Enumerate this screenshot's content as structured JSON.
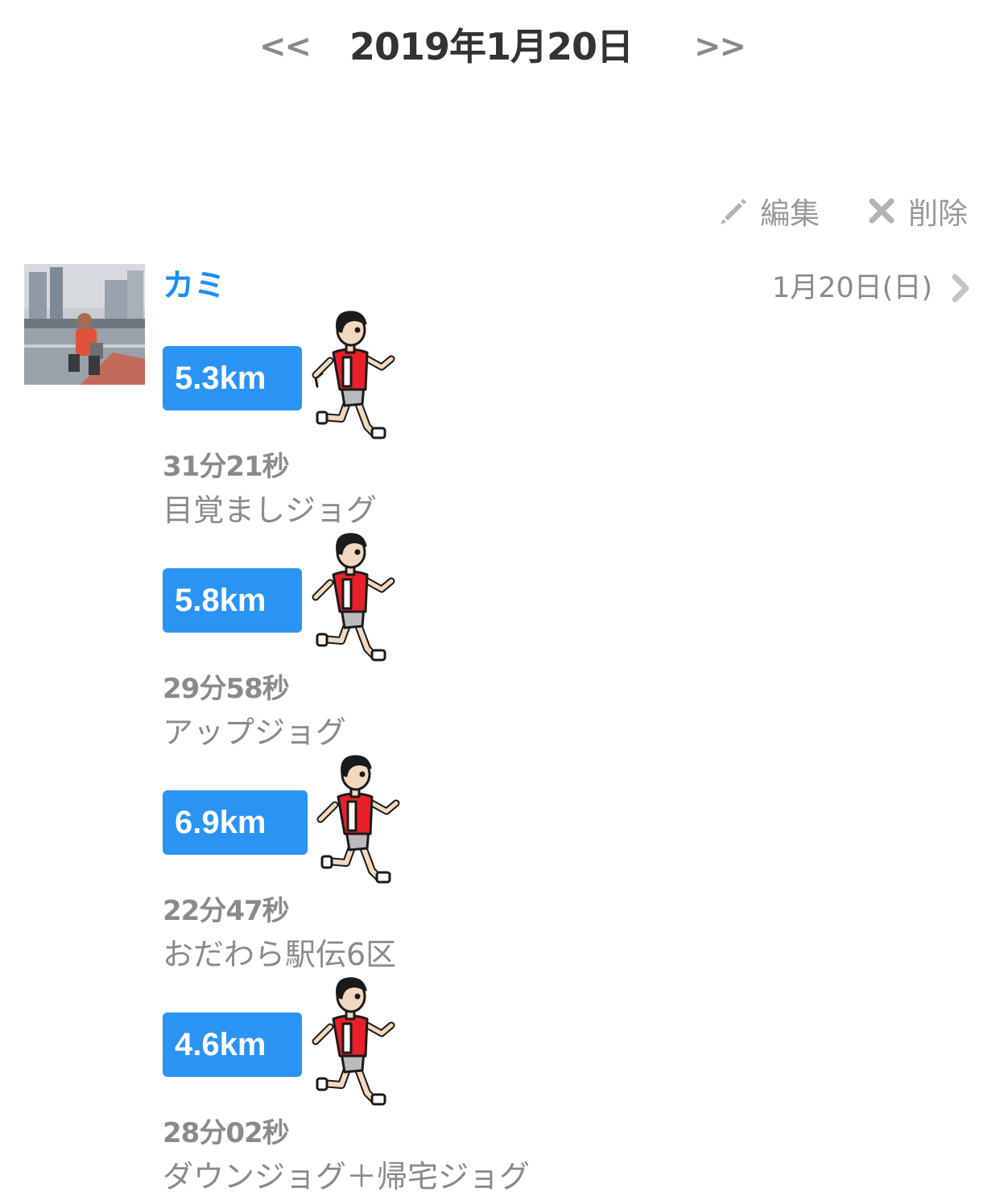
{
  "nav": {
    "prev_label": "<<",
    "date": "2019年1月20日",
    "next_label": ">>"
  },
  "actions": {
    "edit_label": "編集",
    "delete_label": "削除"
  },
  "entry": {
    "user_name": "カミ",
    "date": "1月20日(日)"
  },
  "runs": [
    {
      "distance": "5.3km",
      "duration": "31分21秒",
      "note": "目覚ましジョグ"
    },
    {
      "distance": "5.8km",
      "duration": "29分58秒",
      "note": "アップジョグ"
    },
    {
      "distance": "6.9km",
      "duration": "22分47秒",
      "note": "おだわら駅伝6区"
    },
    {
      "distance": "4.6km",
      "duration": "28分02秒",
      "note": "ダウンジョグ＋帰宅ジョグ"
    }
  ],
  "colors": {
    "accent": "#2a94f4",
    "user_name": "#1a8ff0",
    "muted_text": "#8a8a8a"
  }
}
